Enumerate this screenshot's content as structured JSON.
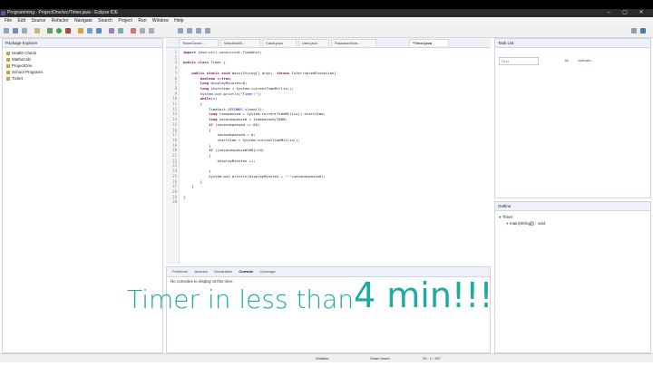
{
  "window": {
    "title": "Programming - ProjectOne/src/Timer.java - Eclipse IDE",
    "controls": [
      "–",
      "▢",
      "✕"
    ]
  },
  "menu": [
    "File",
    "Edit",
    "Source",
    "Refactor",
    "Navigate",
    "Search",
    "Project",
    "Run",
    "Window",
    "Help"
  ],
  "package_explorer": {
    "title": "Package Explorer",
    "items": [
      "Health Check",
      "MathsCalc",
      "ProjectOne",
      "School Programs",
      "Ticket"
    ]
  },
  "editor": {
    "tabs": [
      {
        "label": "TicketGener...",
        "active": false
      },
      {
        "label": "WhichNotB...",
        "active": false
      },
      {
        "label": "Calcb.java",
        "active": false
      },
      {
        "label": "User.java",
        "active": false
      },
      {
        "label": "PasswordGue...",
        "active": false
      },
      {
        "label": "*Timer.java",
        "active": true
      }
    ],
    "lines": [
      {
        "n": "1",
        "t": "import java.util.concurrent.TimeUnit;"
      },
      {
        "n": "2",
        "t": ""
      },
      {
        "n": "3",
        "t": "public class Timer {"
      },
      {
        "n": "4",
        "t": ""
      },
      {
        "n": "5",
        "t": "    public static void main(String[] args)  throws InterruptedException{"
      },
      {
        "n": "6",
        "t": "        boolean x=true;"
      },
      {
        "n": "7",
        "t": "        long displayMinutes=0;"
      },
      {
        "n": "8",
        "t": "        long starttime = System.currentTimeMillis();"
      },
      {
        "n": "9",
        "t": "        System.out.println(\"Timer:\");"
      },
      {
        "n": "10",
        "t": "        while(x)"
      },
      {
        "n": "11",
        "t": "        {"
      },
      {
        "n": "12",
        "t": "            TimeUnit.SECONDS.sleep(1);"
      },
      {
        "n": "13",
        "t": "            long timepassed = System.currentTimeMillis()-starttime;"
      },
      {
        "n": "14",
        "t": "            long secondspassed = timepassed/1000;"
      },
      {
        "n": "15",
        "t": "            if (secondspassed == 60)"
      },
      {
        "n": "16",
        "t": "            {"
      },
      {
        "n": "17",
        "t": "                secondspassed = 0;"
      },
      {
        "n": "18",
        "t": "                starttime = System.currentTimeMillis();"
      },
      {
        "n": "19",
        "t": "            }"
      },
      {
        "n": "20",
        "t": "            if ((secondspassed%60)==0)"
      },
      {
        "n": "21",
        "t": "            {"
      },
      {
        "n": "22",
        "t": "                displayMinutes ++;"
      },
      {
        "n": "23",
        "t": ""
      },
      {
        "n": "24",
        "t": "            }"
      },
      {
        "n": "25",
        "t": "            System.out.println(displayMinutes + \":\"+secondspassed);"
      },
      {
        "n": "26",
        "t": "        }"
      },
      {
        "n": "27",
        "t": "    }"
      },
      {
        "n": "28",
        "t": ""
      },
      {
        "n": "29",
        "t": "}"
      },
      {
        "n": "30",
        "t": ""
      }
    ]
  },
  "task_list": {
    "title": "Task List",
    "find_placeholder": "Find",
    "all_label": "All",
    "activate_label": "Activate..."
  },
  "outline": {
    "title": "Outline",
    "class_name": "Timer",
    "method": "main(String[]) : void"
  },
  "console": {
    "tabs": [
      {
        "label": "Problems",
        "active": false
      },
      {
        "label": "Javadoc",
        "active": false
      },
      {
        "label": "Declaration",
        "active": false
      },
      {
        "label": "Console",
        "active": true
      },
      {
        "label": "Coverage",
        "active": false
      }
    ],
    "message": "No consoles to display at this time."
  },
  "status": {
    "writable": "Writable",
    "insert_mode": "Smart Insert",
    "position": "29 : 1 : 907"
  },
  "overlay": {
    "text_small": "Timer in less than",
    "text_big": "4 min!!!"
  },
  "colors": {
    "overlay": "#1ea9a2",
    "keyword": "#7f0055",
    "string": "#2a00ff",
    "field": "#0000c0"
  }
}
